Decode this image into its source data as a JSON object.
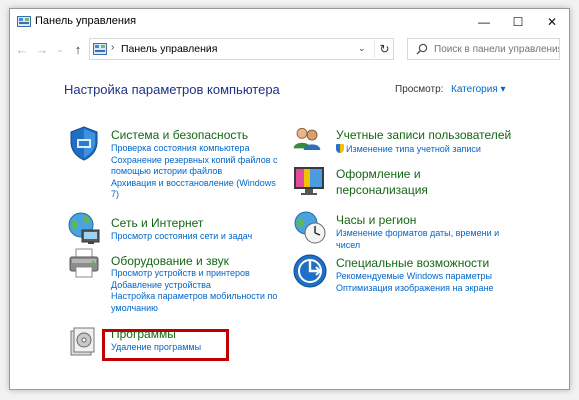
{
  "window": {
    "title": "Панель управления",
    "buttons": {
      "minimize": "—",
      "maximize": "☐",
      "close": "✕"
    }
  },
  "navbar": {
    "back": "←",
    "forward": "→",
    "dropdown": "⌄",
    "up": "↑",
    "address": "Панель управления",
    "separator": "›",
    "refresh": "↻",
    "search_placeholder": "Поиск в панели управления"
  },
  "header": {
    "title": "Настройка параметров компьютера",
    "view_label": "Просмотр:",
    "view_value": "Категория ▾"
  },
  "categories_left": [
    {
      "title": "Система и безопасность",
      "icon": "shield-icon",
      "links": [
        "Проверка состояния компьютера",
        "Сохранение резервных копий файлов с",
        "помощью истории файлов",
        "Архивация и восстановление (Windows",
        "7)"
      ]
    },
    {
      "title": "Сеть и Интернет",
      "icon": "network-icon",
      "links": [
        "Просмотр состояния сети и задач"
      ]
    },
    {
      "title": "Оборудование и звук",
      "icon": "printer-icon",
      "links": [
        "Просмотр устройств и принтеров",
        "Добавление устройства",
        "Настройка параметров мобильности по",
        "умолчанию"
      ]
    },
    {
      "title": "Программы",
      "icon": "programs-icon",
      "links": [
        "Удаление программы"
      ]
    }
  ],
  "categories_right": [
    {
      "title": "Учетные записи пользователей",
      "icon": "users-icon",
      "links": [
        "Изменение типа учетной записи"
      ]
    },
    {
      "title": "Оформление и",
      "title2": "персонализация",
      "icon": "appearance-icon",
      "links": []
    },
    {
      "title": "Часы и регион",
      "icon": "clock-globe-icon",
      "links": [
        "Изменение форматов даты, времени и",
        "чисел"
      ]
    },
    {
      "title": "Специальные возможности",
      "icon": "accessibility-icon",
      "links": [
        "Рекомендуемые Windows параметры",
        "Оптимизация изображения на экране"
      ]
    }
  ],
  "colors": {
    "category_title": "#156615",
    "link": "#0066cc",
    "page_title": "#1e3287",
    "highlight": "#c00000"
  }
}
